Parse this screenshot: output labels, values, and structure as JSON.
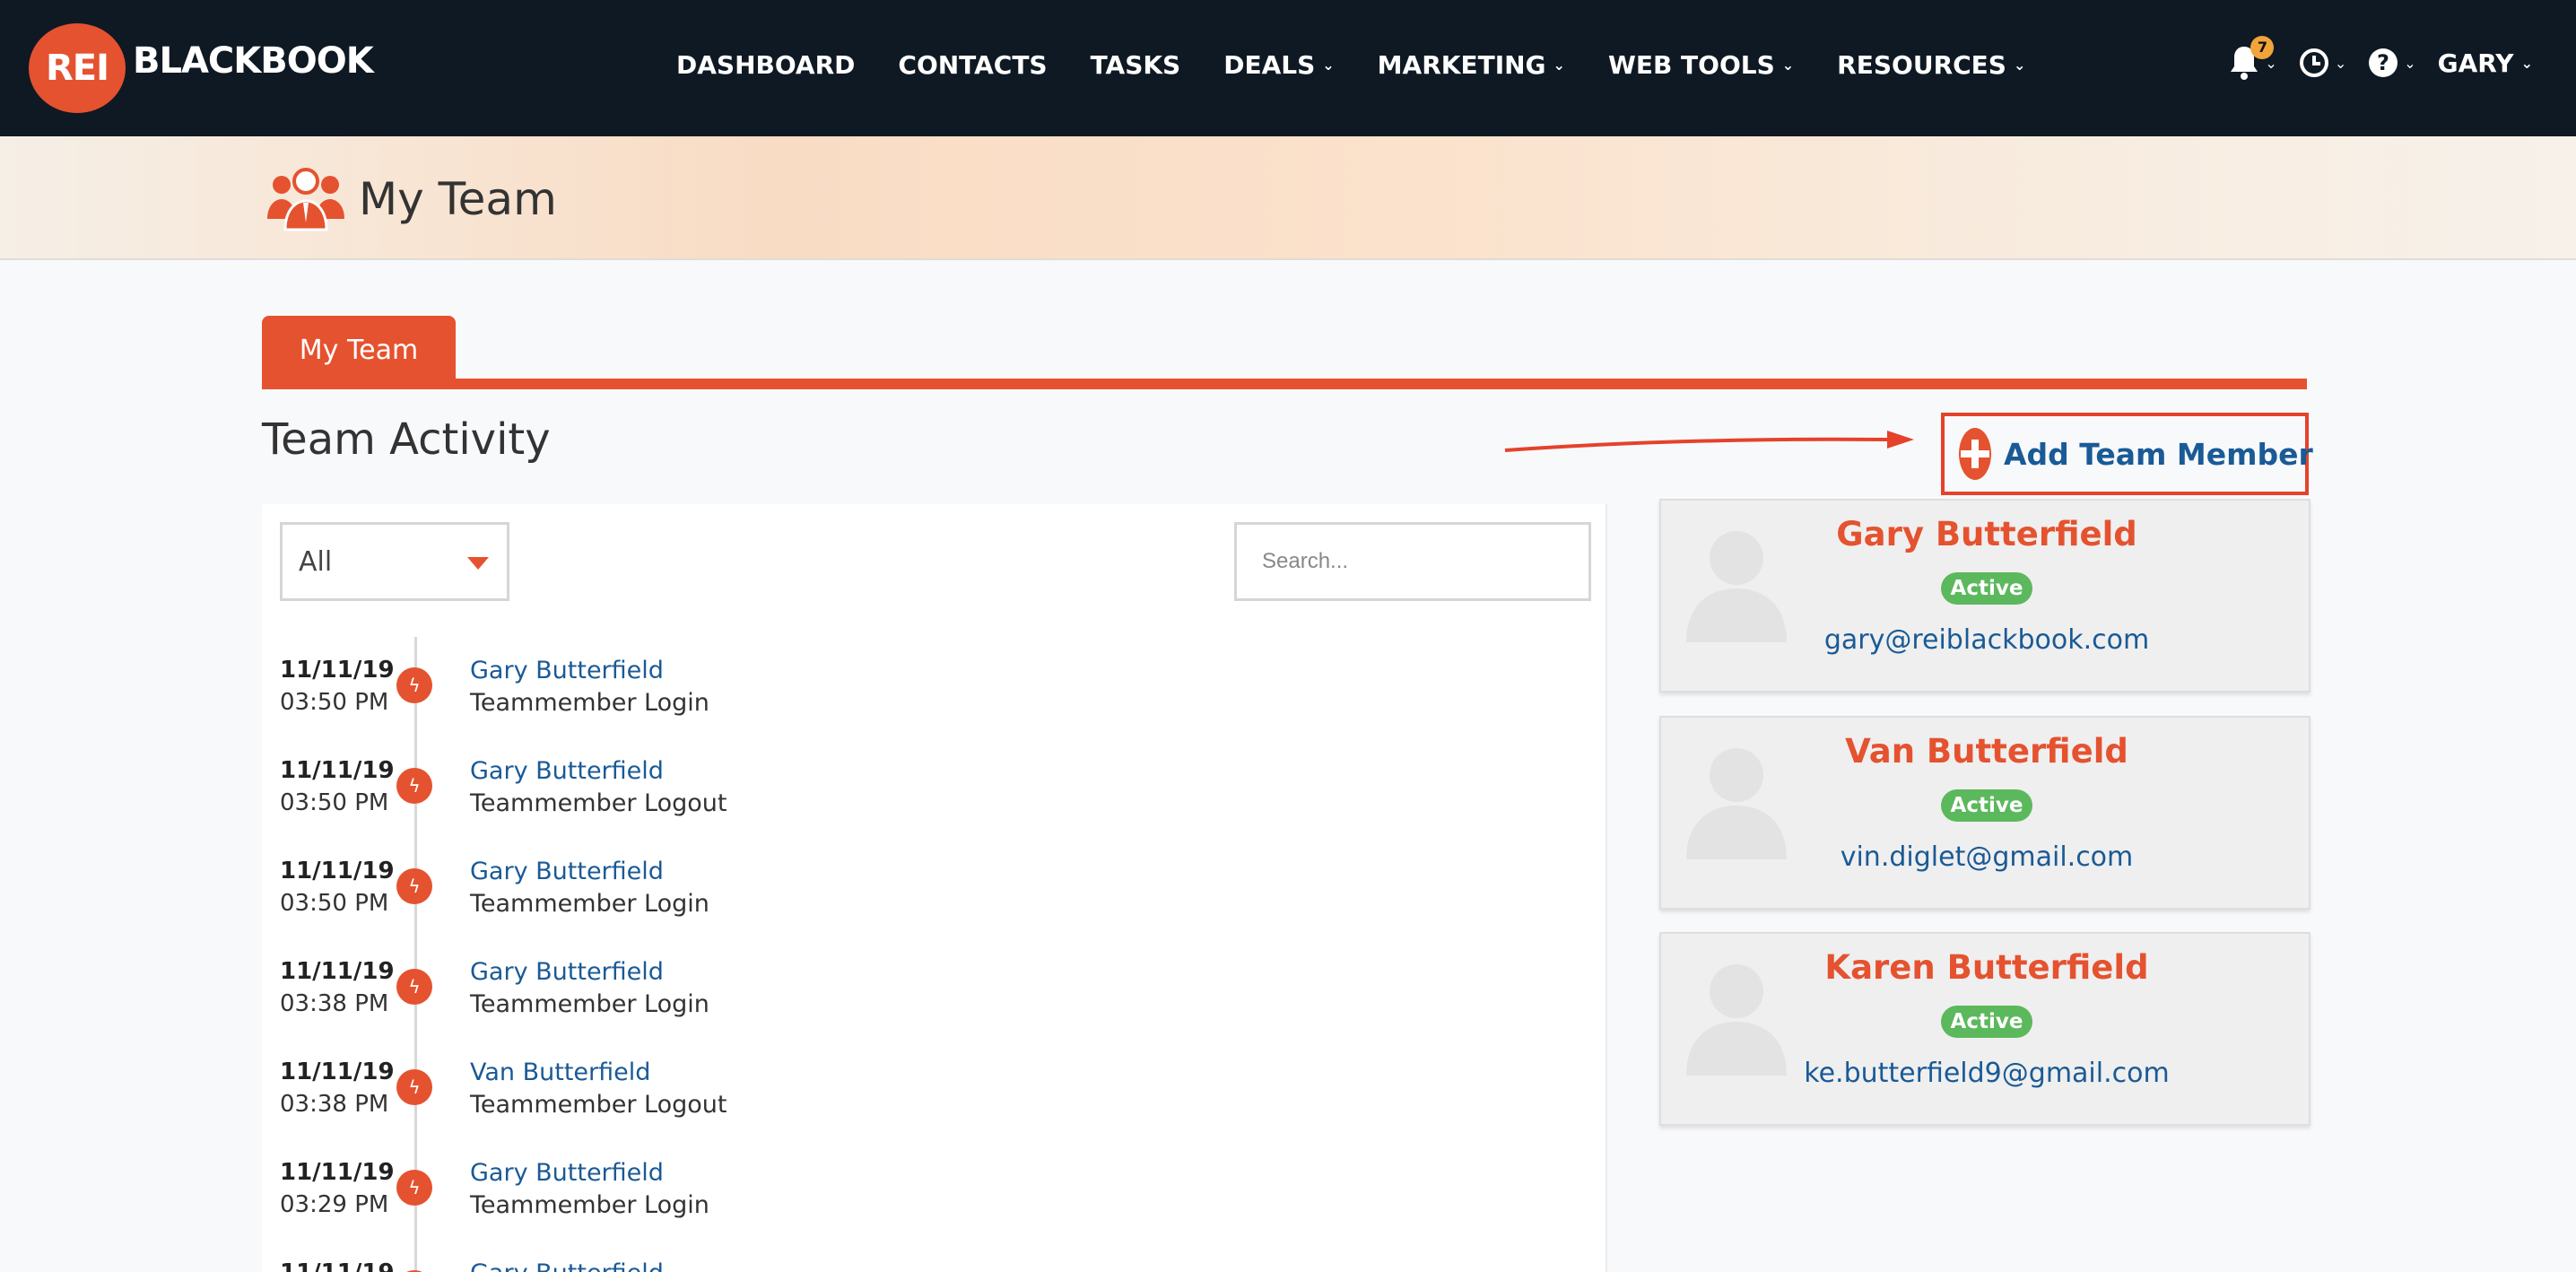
{
  "brand": {
    "logo_mark": "REI",
    "logo_text": "BLACKBOOK"
  },
  "nav": {
    "items": [
      {
        "label": "DASHBOARD",
        "dropdown": false
      },
      {
        "label": "CONTACTS",
        "dropdown": false
      },
      {
        "label": "TASKS",
        "dropdown": false
      },
      {
        "label": "DEALS",
        "dropdown": true
      },
      {
        "label": "MARKETING",
        "dropdown": true
      },
      {
        "label": "WEB TOOLS",
        "dropdown": true
      },
      {
        "label": "RESOURCES",
        "dropdown": true
      }
    ],
    "notification_count": "7",
    "user": "GARY"
  },
  "page": {
    "title": "My Team"
  },
  "tabs": [
    {
      "label": "My Team",
      "active": true
    }
  ],
  "activity": {
    "title": "Team Activity",
    "filter_value": "All",
    "search_placeholder": "Search...",
    "items": [
      {
        "date": "11/11/19",
        "time": "03:50 PM",
        "member": "Gary Butterfield",
        "action": "Teammember Login"
      },
      {
        "date": "11/11/19",
        "time": "03:50 PM",
        "member": "Gary Butterfield",
        "action": "Teammember Logout"
      },
      {
        "date": "11/11/19",
        "time": "03:50 PM",
        "member": "Gary Butterfield",
        "action": "Teammember Login"
      },
      {
        "date": "11/11/19",
        "time": "03:38 PM",
        "member": "Gary Butterfield",
        "action": "Teammember Login"
      },
      {
        "date": "11/11/19",
        "time": "03:38 PM",
        "member": "Van Butterfield",
        "action": "Teammember Logout"
      },
      {
        "date": "11/11/19",
        "time": "03:29 PM",
        "member": "Gary Butterfield",
        "action": "Teammember Login"
      },
      {
        "date": "11/11/19",
        "time": "",
        "member": "Gary Butterfield",
        "action": ""
      }
    ]
  },
  "add_member": {
    "label": "Add Team Member"
  },
  "members": [
    {
      "name": "Gary Butterfield",
      "status": "Active",
      "email": "gary@reiblackbook.com"
    },
    {
      "name": "Van Butterfield",
      "status": "Active",
      "email": "vin.diglet@gmail.com"
    },
    {
      "name": "Karen Butterfield",
      "status": "Active",
      "email": "ke.butterfield9@gmail.com"
    }
  ],
  "colors": {
    "accent": "#e5522f",
    "link": "#1a5a96",
    "nav_bg": "#0f1923",
    "active_badge": "#5cb85c"
  }
}
